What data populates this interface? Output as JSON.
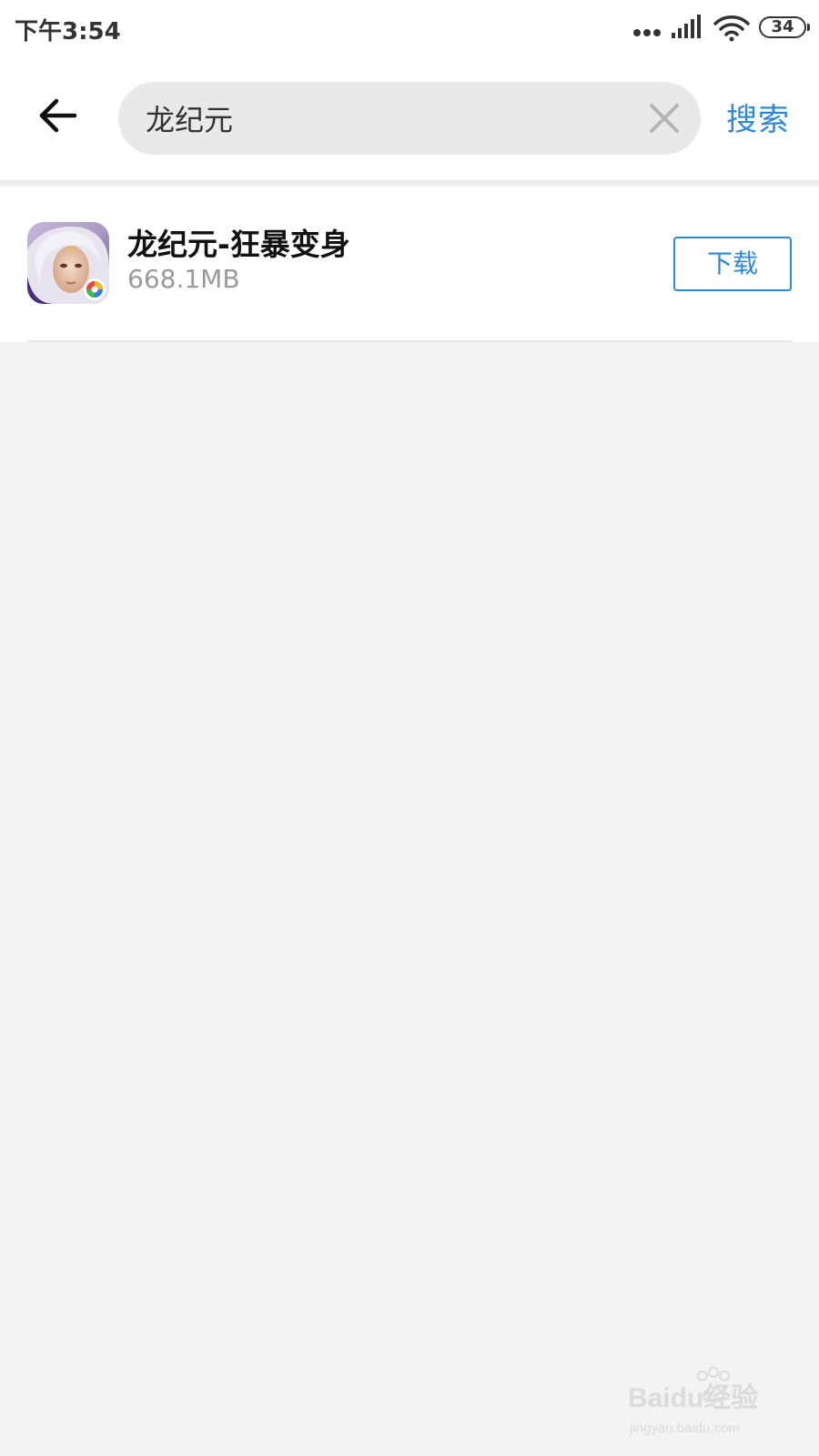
{
  "status_bar": {
    "time": "下午3:54",
    "battery": "34"
  },
  "header": {
    "search_value": "龙纪元",
    "search_button_label": "搜索"
  },
  "results": [
    {
      "title": "龙纪元-狂暴变身",
      "size": "668.1MB",
      "download_label": "下载"
    }
  ],
  "watermark": {
    "brand": "Baidu经验",
    "url": "jingyan.baidu.com"
  },
  "colors": {
    "accent": "#2f87d8",
    "background": "#f3f3f3"
  }
}
